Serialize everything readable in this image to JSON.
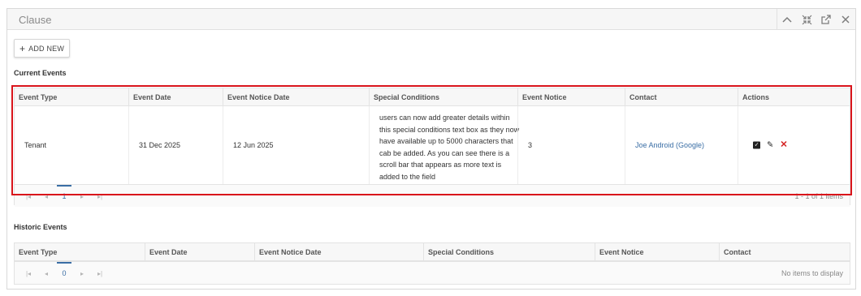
{
  "panel": {
    "title": "Clause"
  },
  "header_icons": [
    "chevron-up-icon",
    "collapse-icon",
    "popout-icon",
    "close-icon"
  ],
  "toolbar": {
    "add_new_label": "ADD NEW"
  },
  "current_events": {
    "title": "Current Events",
    "columns": [
      "Event Type",
      "Event Date",
      "Event Notice Date",
      "Special Conditions",
      "Event Notice",
      "Contact",
      "Actions"
    ],
    "rows": [
      {
        "event_type": "Tenant",
        "event_date": "31 Dec 2025",
        "event_notice_date": "12 Jun 2025",
        "special_conditions": "users can now add greater details within this special conditions text box as they now have available up to 5000 characters that cab be added. As you can see there is a scroll bar that appears as more text is added to the field",
        "event_notice": "3",
        "contact": "Joe Android (Google)"
      }
    ],
    "pager_info": "1 - 1 of 1 items"
  },
  "historic_events": {
    "title": "Historic Events",
    "columns": [
      "Event Type",
      "Event Date",
      "Event Notice Date",
      "Special Conditions",
      "Event Notice",
      "Contact"
    ],
    "pager_page": "0",
    "pager_info": "No items to display"
  },
  "colors": {
    "highlight": "#d9141b",
    "link": "#3a6ea5",
    "delete": "#d42222"
  }
}
